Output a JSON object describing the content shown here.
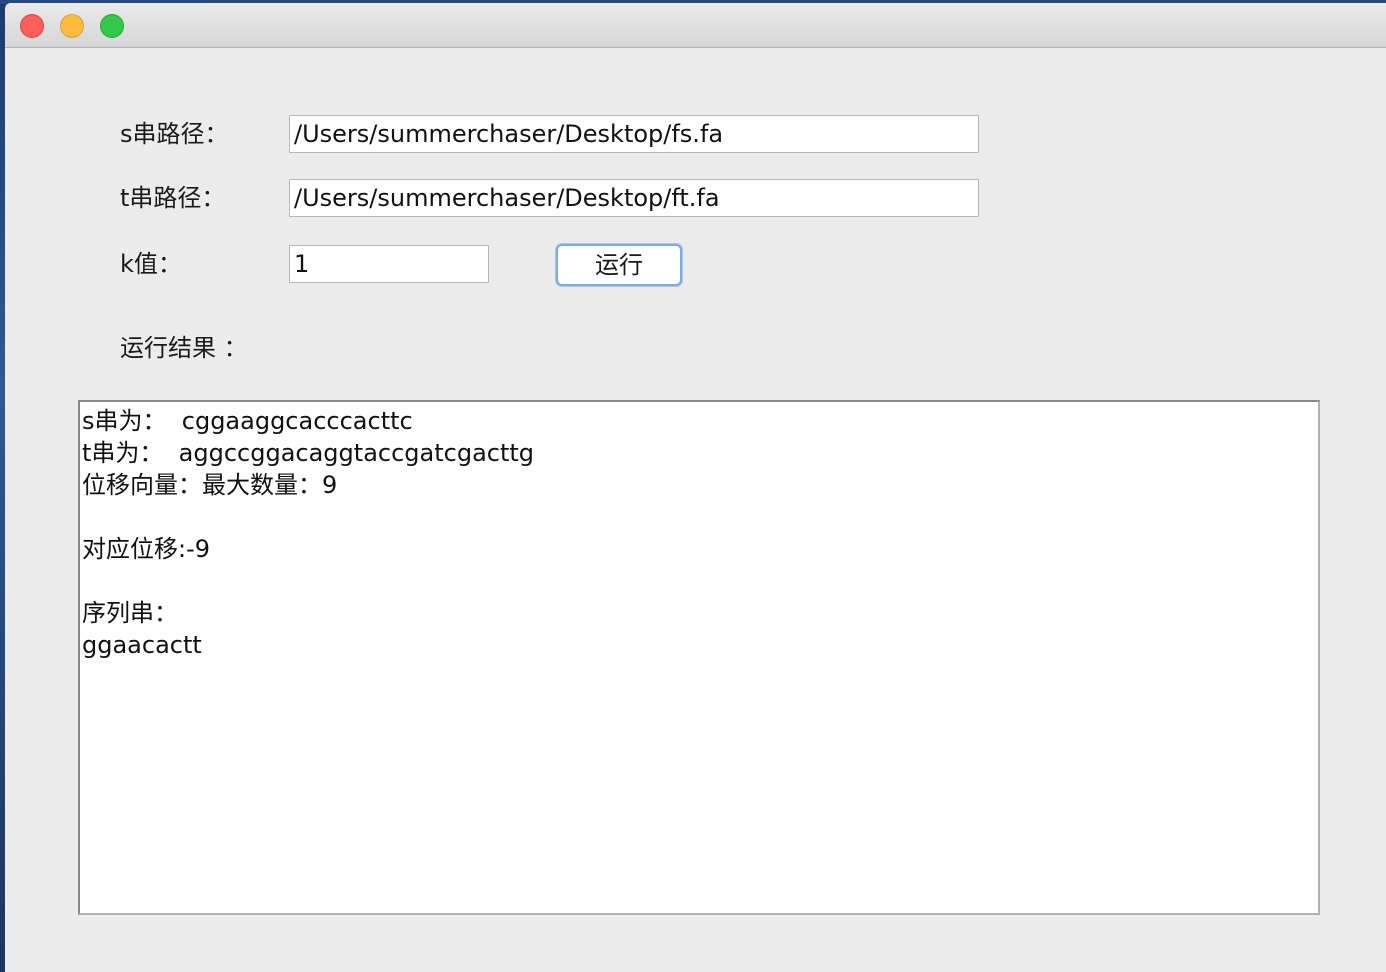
{
  "form": {
    "s_path_label": "s串路径：",
    "s_path_value": "/Users/summerchaser/Desktop/fs.fa",
    "t_path_label": "t串路径：",
    "t_path_value": "/Users/summerchaser/Desktop/ft.fa",
    "k_label": "k值：",
    "k_value": "1",
    "run_button": "运行"
  },
  "result": {
    "label": "运行结果 ：",
    "lines": [
      "s串为：  cggaaggcacccacttc",
      "t串为：  aggccggacaggtaccgatcgacttg",
      "位移向量：最大数量：9",
      "",
      "对应位移:-9",
      "",
      "序列串：",
      "ggaacactt"
    ]
  },
  "colors": {
    "window_bg": "#ececec",
    "close": "#fc605c",
    "minimize": "#fdbc40",
    "zoom": "#34c84a",
    "button_focus": "#7fa9e0"
  }
}
